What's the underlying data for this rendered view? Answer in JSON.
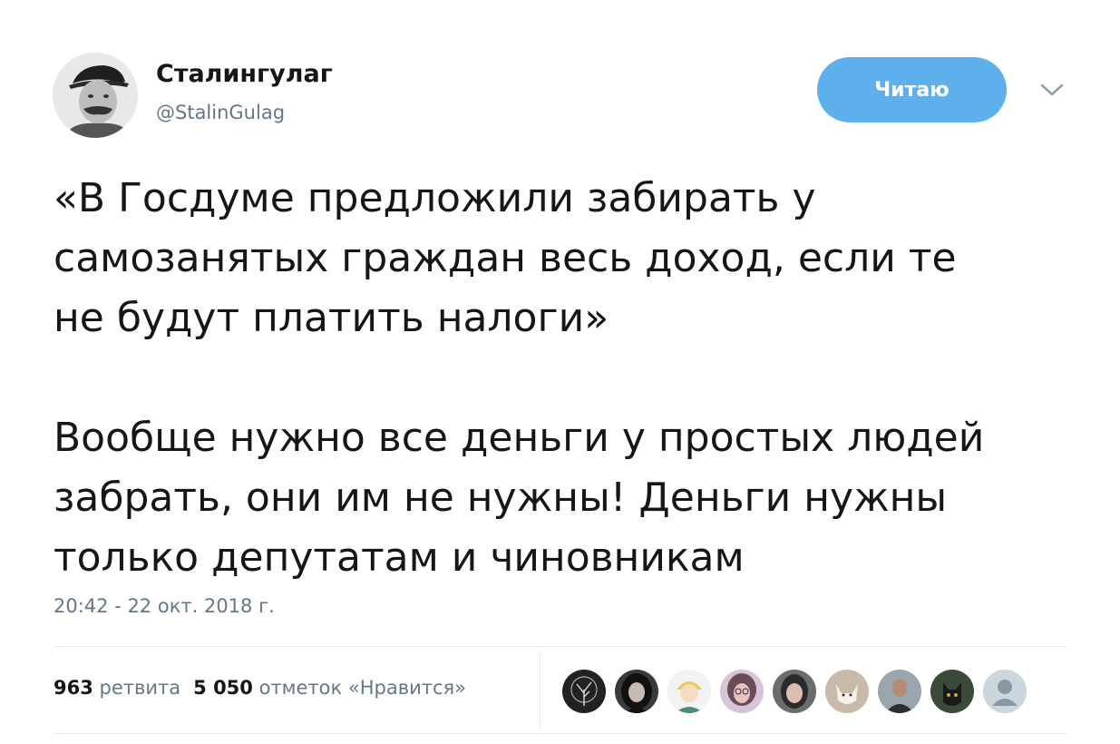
{
  "user": {
    "display_name": "Сталингулаг",
    "handle": "@StalinGulag"
  },
  "follow_button": {
    "label": "Читаю"
  },
  "tweet": {
    "paragraphs": [
      [
        "«В Госдуме предложили забирать у",
        "самозанятых граждан весь доход, если те",
        "не будут платить налоги»"
      ],
      [
        "Вообще нужно все деньги у простых людей",
        "забрать, они им не нужны! Деньги нужны",
        "только депутатам и чиновникам"
      ]
    ],
    "timestamp": "20:42 - 22 окт. 2018 г."
  },
  "stats": {
    "retweets_count": "963",
    "retweets_label": "ретвита",
    "likes_count": "5 050",
    "likes_label": "отметок «Нравится»"
  },
  "likers": [
    {
      "icon": "tree-avatar-icon"
    },
    {
      "icon": "woman-avatar-icon"
    },
    {
      "icon": "cartoon-avatar-icon"
    },
    {
      "icon": "girl-avatar-icon"
    },
    {
      "icon": "woman-avatar-icon"
    },
    {
      "icon": "cat-avatar-icon"
    },
    {
      "icon": "man-avatar-icon"
    },
    {
      "icon": "cat-avatar-icon"
    },
    {
      "icon": "default-avatar-icon"
    }
  ],
  "colors": {
    "follow_button": "#5eb0ec",
    "text": "#14171a",
    "muted": "#657786",
    "divider": "#e6ecf0"
  }
}
